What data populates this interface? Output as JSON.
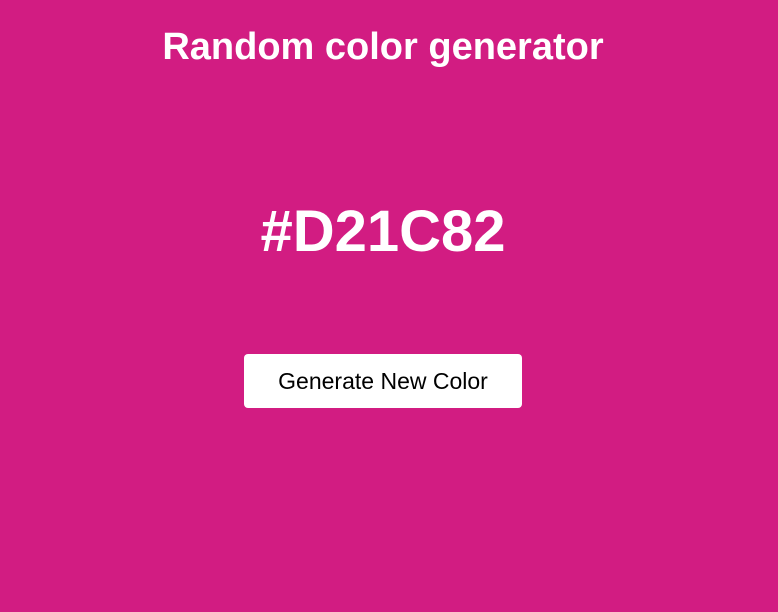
{
  "app": {
    "title": "Random color generator"
  },
  "color": {
    "hex": "#D21C82",
    "background": "#D21C82",
    "text_color": "#ffffff"
  },
  "actions": {
    "generate_label": "Generate New Color"
  }
}
